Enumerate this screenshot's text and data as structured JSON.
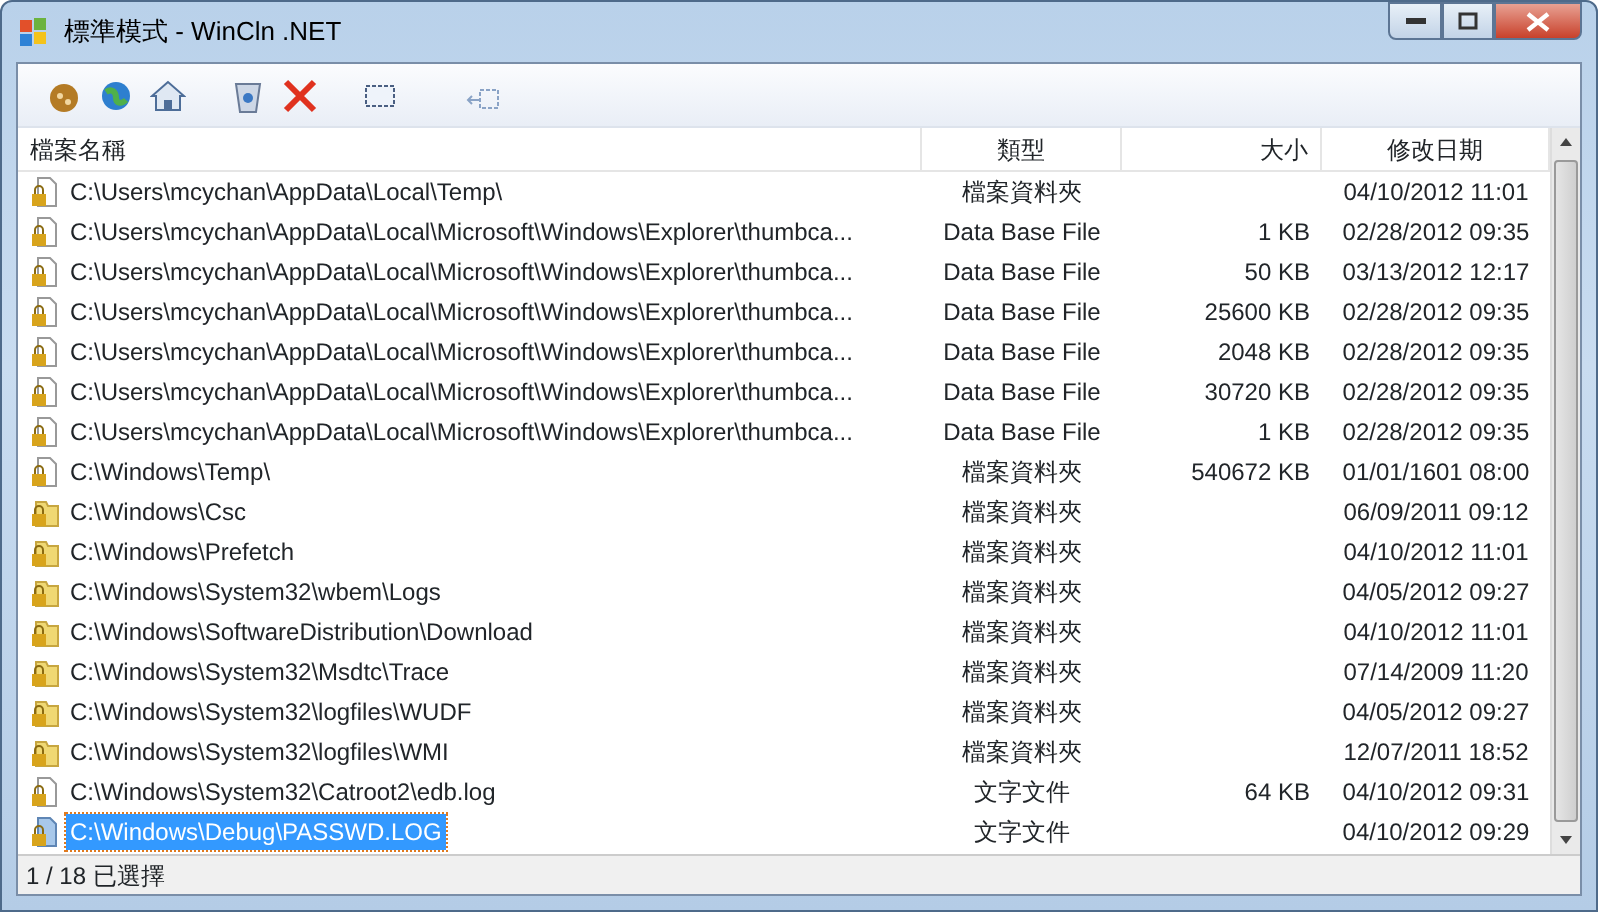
{
  "window": {
    "title": "標準模式 - WinCln .NET"
  },
  "table": {
    "columns": [
      "檔案名稱",
      "類型",
      "大小",
      "修改日期"
    ],
    "rows": [
      {
        "kind": "page",
        "name": "C:\\Users\\mcychan\\AppData\\Local\\Temp\\",
        "type": "檔案資料夾",
        "size": "",
        "modified": "04/10/2012 11:01",
        "selected": false
      },
      {
        "kind": "page",
        "name": "C:\\Users\\mcychan\\AppData\\Local\\Microsoft\\Windows\\Explorer\\thumbca...",
        "type": "Data Base File",
        "size": "1 KB",
        "modified": "02/28/2012 09:35",
        "selected": false
      },
      {
        "kind": "page",
        "name": "C:\\Users\\mcychan\\AppData\\Local\\Microsoft\\Windows\\Explorer\\thumbca...",
        "type": "Data Base File",
        "size": "50 KB",
        "modified": "03/13/2012 12:17",
        "selected": false
      },
      {
        "kind": "page",
        "name": "C:\\Users\\mcychan\\AppData\\Local\\Microsoft\\Windows\\Explorer\\thumbca...",
        "type": "Data Base File",
        "size": "25600 KB",
        "modified": "02/28/2012 09:35",
        "selected": false
      },
      {
        "kind": "page",
        "name": "C:\\Users\\mcychan\\AppData\\Local\\Microsoft\\Windows\\Explorer\\thumbca...",
        "type": "Data Base File",
        "size": "2048 KB",
        "modified": "02/28/2012 09:35",
        "selected": false
      },
      {
        "kind": "page",
        "name": "C:\\Users\\mcychan\\AppData\\Local\\Microsoft\\Windows\\Explorer\\thumbca...",
        "type": "Data Base File",
        "size": "30720 KB",
        "modified": "02/28/2012 09:35",
        "selected": false
      },
      {
        "kind": "page",
        "name": "C:\\Users\\mcychan\\AppData\\Local\\Microsoft\\Windows\\Explorer\\thumbca...",
        "type": "Data Base File",
        "size": "1 KB",
        "modified": "02/28/2012 09:35",
        "selected": false
      },
      {
        "kind": "page",
        "name": "C:\\Windows\\Temp\\",
        "type": "檔案資料夾",
        "size": "540672 KB",
        "modified": "01/01/1601 08:00",
        "selected": false
      },
      {
        "kind": "folder",
        "name": "C:\\Windows\\Csc",
        "type": "檔案資料夾",
        "size": "",
        "modified": "06/09/2011 09:12",
        "selected": false
      },
      {
        "kind": "folder",
        "name": "C:\\Windows\\Prefetch",
        "type": "檔案資料夾",
        "size": "",
        "modified": "04/10/2012 11:01",
        "selected": false
      },
      {
        "kind": "folder",
        "name": "C:\\Windows\\System32\\wbem\\Logs",
        "type": "檔案資料夾",
        "size": "",
        "modified": "04/05/2012 09:27",
        "selected": false
      },
      {
        "kind": "folder",
        "name": "C:\\Windows\\SoftwareDistribution\\Download",
        "type": "檔案資料夾",
        "size": "",
        "modified": "04/10/2012 11:01",
        "selected": false
      },
      {
        "kind": "folder",
        "name": "C:\\Windows\\System32\\Msdtc\\Trace",
        "type": "檔案資料夾",
        "size": "",
        "modified": "07/14/2009 11:20",
        "selected": false
      },
      {
        "kind": "folder",
        "name": "C:\\Windows\\System32\\logfiles\\WUDF",
        "type": "檔案資料夾",
        "size": "",
        "modified": "04/05/2012 09:27",
        "selected": false
      },
      {
        "kind": "folder",
        "name": "C:\\Windows\\System32\\logfiles\\WMI",
        "type": "檔案資料夾",
        "size": "",
        "modified": "12/07/2011 18:52",
        "selected": false
      },
      {
        "kind": "page",
        "name": "C:\\Windows\\System32\\Catroot2\\edb.log",
        "type": "文字文件",
        "size": "64 KB",
        "modified": "04/10/2012 09:31",
        "selected": false
      },
      {
        "kind": "page",
        "name": "C:\\Windows\\Debug\\PASSWD.LOG",
        "type": "文字文件",
        "size": "",
        "modified": "04/10/2012 09:29",
        "selected": true
      }
    ]
  },
  "status_bar": "1 / 18 已選擇"
}
